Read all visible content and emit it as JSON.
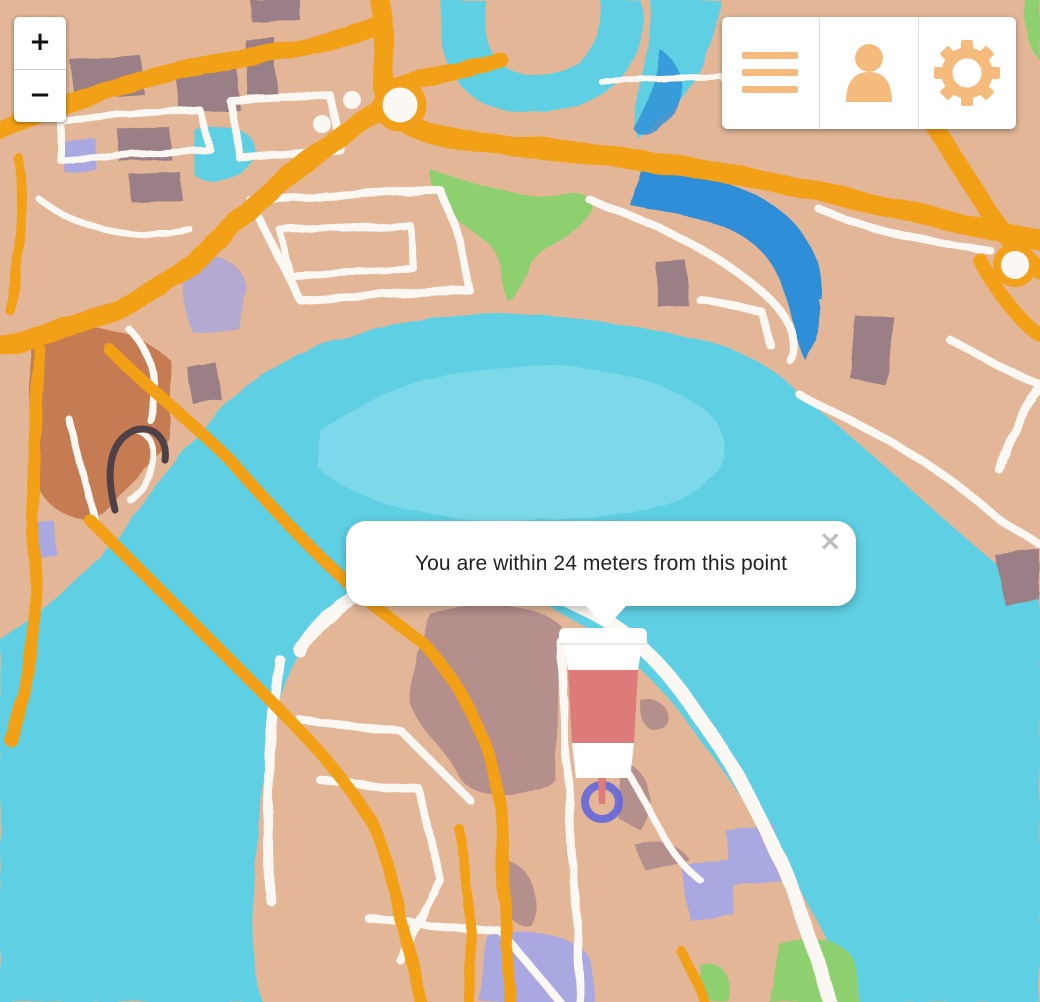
{
  "map": {
    "style": "watercolor",
    "colors": {
      "water": "#5fd0e4",
      "water_deep": "#2f8fd8",
      "land": "#e2b697",
      "road_major": "#f2a019",
      "road_minor": "#fbf7f2",
      "park": "#8ed070",
      "building": "#b58f8c",
      "building_blue": "#a9a8e0"
    }
  },
  "zoom_control": {
    "zoom_in_label": "+",
    "zoom_out_label": "−"
  },
  "toolbar": {
    "accent": "#f5bb7c",
    "buttons": [
      {
        "name": "menu",
        "icon": "hamburger-menu-icon"
      },
      {
        "name": "profile",
        "icon": "user-icon"
      },
      {
        "name": "settings",
        "icon": "gear-icon"
      }
    ]
  },
  "popup": {
    "text": "You are within 24 meters from this point",
    "close_label": "×"
  },
  "marker": {
    "icon": "coffee-cup-icon",
    "cup_color": "#dd7b7b",
    "location_ring_color": "#5b63e0"
  }
}
